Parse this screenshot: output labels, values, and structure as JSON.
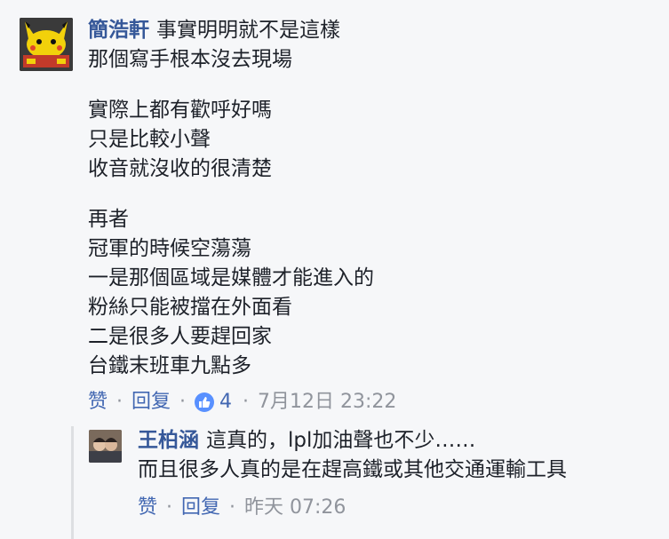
{
  "comment": {
    "author": "簡浩軒",
    "lines": [
      "事實明明就不是這樣",
      "那個寫手根本沒去現場",
      "實際上都有歡呼好嗎",
      "只是比較小聲",
      "收音就沒收的很清楚",
      "再者",
      "冠軍的時候空蕩蕩",
      "一是那個區域是媒體才能進入的",
      "粉絲只能被擋在外面看",
      "二是很多人要趕回家",
      "台鐵末班車九點多"
    ],
    "actions": {
      "like": "赞",
      "reply": "回复",
      "like_count": "4",
      "timestamp": "7月12日 23:22"
    }
  },
  "reply": {
    "author": "王柏涵",
    "lines": [
      "這真的，lpl加油聲也不少……",
      "而且很多人真的是在趕高鐵或其他交通運輸工具"
    ],
    "actions": {
      "like": "赞",
      "reply": "回复",
      "timestamp": "昨天 07:26"
    }
  },
  "colors": {
    "author": "#365899",
    "action_link": "#4267b2",
    "meta": "#90949c",
    "like_badge": "#5890ff"
  }
}
